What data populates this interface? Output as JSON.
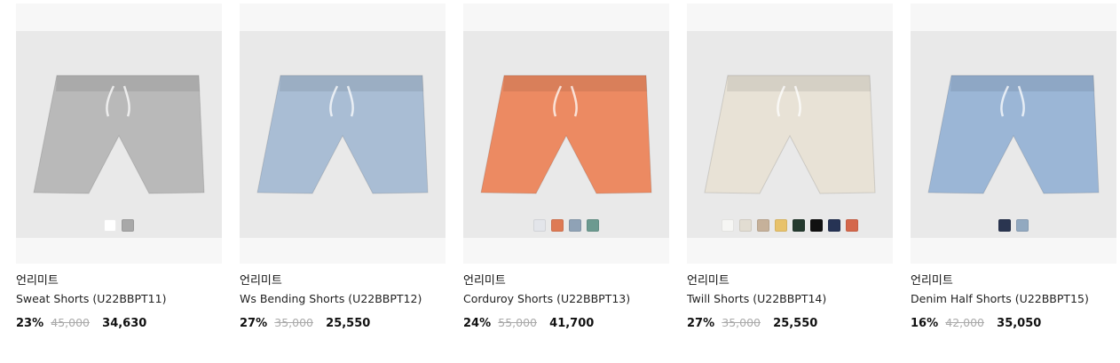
{
  "products": [
    {
      "brand": "언리미트",
      "name": "Sweat Shorts (U22BBPT11)",
      "discount": "23%",
      "original_price": "45,000",
      "sale_price": "34,630",
      "product_color": "#b9b9b9",
      "swatches": [
        "#ffffff",
        "#a8a8a8"
      ]
    },
    {
      "brand": "언리미트",
      "name": "Ws Bending Shorts (U22BBPT12)",
      "discount": "27%",
      "original_price": "35,000",
      "sale_price": "25,550",
      "product_color": "#a9bdd4",
      "swatches": []
    },
    {
      "brand": "언리미트",
      "name": "Corduroy Shorts (U22BBPT13)",
      "discount": "24%",
      "original_price": "55,000",
      "sale_price": "41,700",
      "product_color": "#ec8a62",
      "swatches": [
        "#e3e5ea",
        "#de7a54",
        "#8fa2b6",
        "#6c9a90"
      ]
    },
    {
      "brand": "언리미트",
      "name": "Twill Shorts (U22BBPT14)",
      "discount": "27%",
      "original_price": "35,000",
      "sale_price": "25,550",
      "product_color": "#e8e2d6",
      "swatches": [
        "#f6f6f4",
        "#e2ddd2",
        "#c6b19a",
        "#e8c26a",
        "#243a2e",
        "#111111",
        "#263354",
        "#d4674b"
      ]
    },
    {
      "brand": "언리미트",
      "name": "Denim Half Shorts (U22BBPT15)",
      "discount": "16%",
      "original_price": "42,000",
      "sale_price": "35,050",
      "product_color": "#9bb6d6",
      "swatches": [
        "#2a3550",
        "#92a9c0"
      ]
    }
  ]
}
